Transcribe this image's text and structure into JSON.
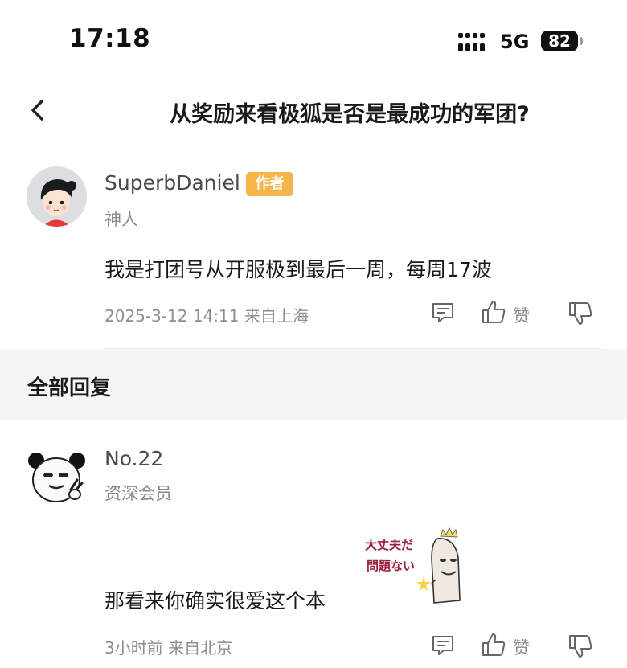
{
  "status_bar": {
    "time": "17:18",
    "network": "5G",
    "battery": "82"
  },
  "nav": {
    "title": "从奖励来看极狐是否是最成功的军团?"
  },
  "post": {
    "author_name": "SuperbDaniel",
    "author_badge": "作者",
    "author_title": "神人",
    "content": "我是打团号从开服极到最后一周，每周17波",
    "meta": "2025-3-12 14:11 来自上海",
    "like_label": "赞"
  },
  "replies_section": {
    "title": "全部回复"
  },
  "reply": {
    "author_name": "No.22",
    "author_title": "资深会员",
    "content": "那看来你确实很爱这个本",
    "sticker_text": [
      "大丈夫だ",
      "問題ない"
    ],
    "meta": "3小时前 来自北京",
    "like_label": "赞"
  },
  "colors": {
    "badge": "#f4b64b",
    "section_band": "#f5f5f5",
    "meta_text": "#8e8e8e"
  },
  "icons": [
    "back-icon",
    "comment-icon",
    "thumbs-up-icon",
    "thumbs-down-icon",
    "signal-icon"
  ]
}
